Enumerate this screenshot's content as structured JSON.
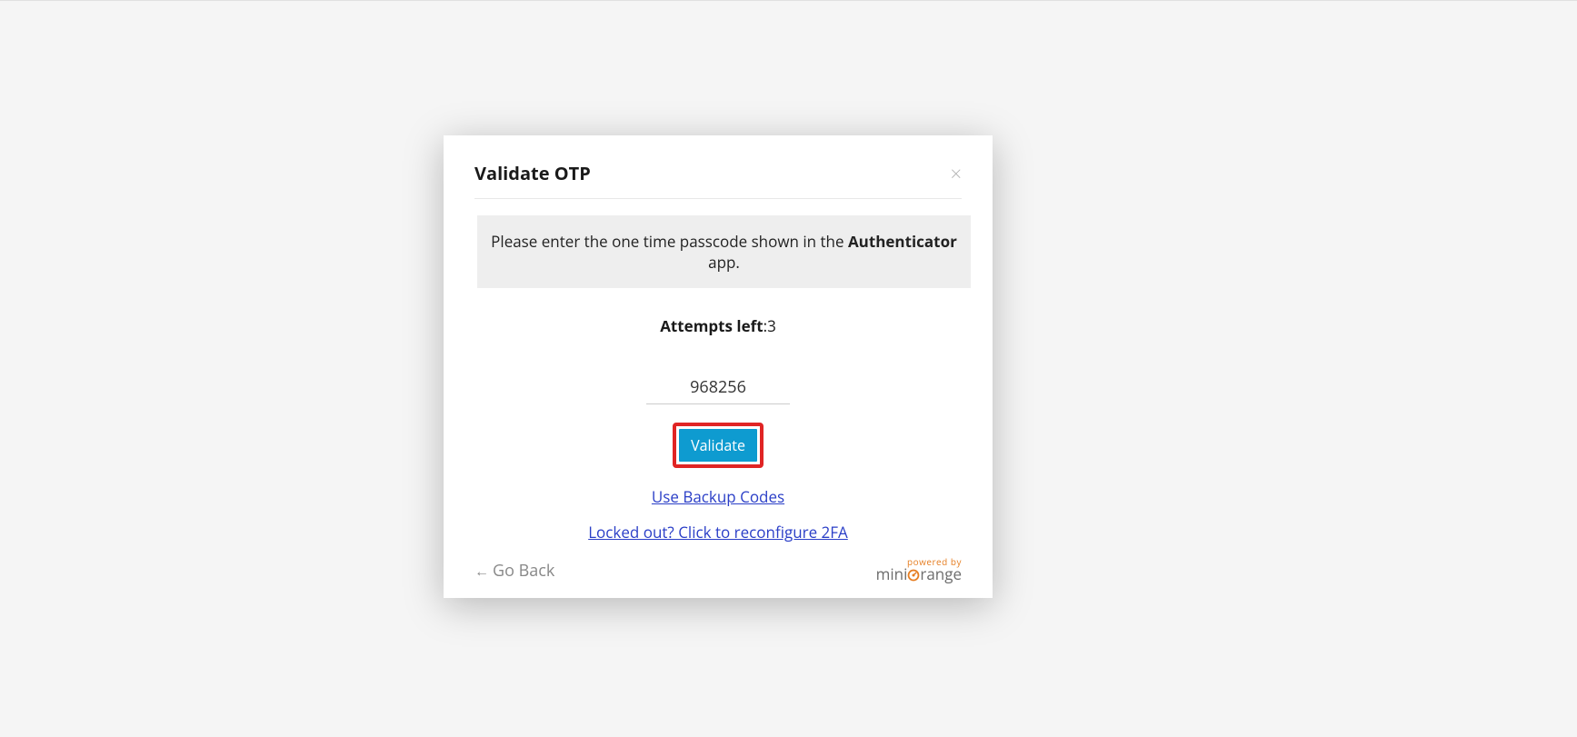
{
  "modal": {
    "title": "Validate OTP",
    "close_icon": "×",
    "instructions_prefix": "Please enter the one time passcode shown in the ",
    "instructions_bold": "Authenticator",
    "instructions_suffix": " app.",
    "attempts_label": "Attempts left",
    "attempts_sep": ":",
    "attempts_value": "3",
    "otp_value": "968256",
    "validate_label": "Validate",
    "backup_link": "Use Backup Codes",
    "locked_link": "Locked out? Click to reconfigure 2FA",
    "go_back_arrow": "←",
    "go_back_label": "Go Back",
    "brand_top": "powered by",
    "brand_bottom": "miniOrange"
  },
  "colors": {
    "highlight": "#e02424",
    "button_bg": "#0e9bd0",
    "link": "#2a3ec7",
    "brand_accent": "#e67e22"
  }
}
